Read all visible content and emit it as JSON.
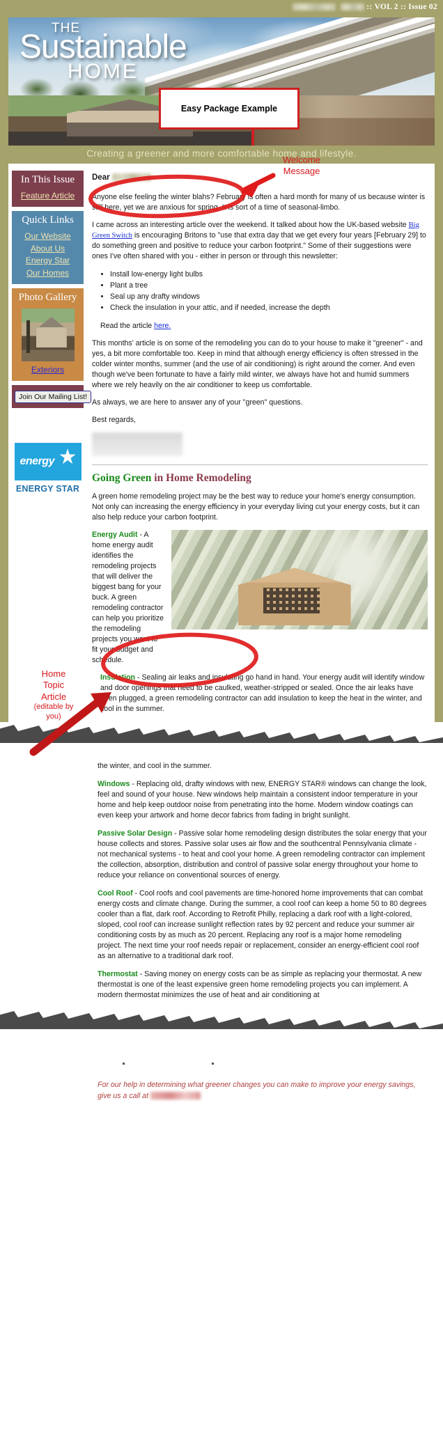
{
  "header": {
    "issue_separator": "::",
    "volume": "VOL 2",
    "issue": "Issue 02",
    "issue_line": ":: VOL 2 :: Issue 02"
  },
  "masthead": {
    "the": "THE",
    "sustainable": "Sustainable",
    "home": "HOME",
    "tagline": "Creating a greener and more comfortable home and lifestyle."
  },
  "callout": {
    "title": "Easy Package Example"
  },
  "annotations": [
    {
      "id": "welcome",
      "label": "Welcome\nMessage",
      "line1": "Welcome",
      "line2": "Message"
    },
    {
      "id": "home-topic",
      "line1": "Home",
      "line2": "Topic",
      "line3": "Article",
      "line4": "(editable by",
      "line5": "you)"
    }
  ],
  "annotation_welcome": {
    "line1": "Welcome",
    "line2": "Message"
  },
  "annotation_topic": {
    "line1": "Home",
    "line2": "Topic",
    "line3": "Article",
    "line4": "(editable by",
    "line5": "you)"
  },
  "sidebar": {
    "in_this_issue": {
      "title": "In This Issue",
      "links": [
        "Feature Article"
      ]
    },
    "quick_links": {
      "title": "Quick Links",
      "links": [
        "Our Website",
        "About Us",
        "Energy Star",
        "Our Homes"
      ]
    },
    "photo_gallery": {
      "title": "Photo Gallery",
      "caption": "Exteriors"
    },
    "mailing_list": {
      "button_label": "Join Our Mailing List!"
    },
    "energy_star": {
      "word": "energy",
      "label": "ENERGY STAR"
    }
  },
  "letter": {
    "greeting": "Dear",
    "greeting_name_redacted": true,
    "p1": "Anyone else feeling the winter blahs? February is often a hard month for many of us because winter is still here, yet we are anxious for spring. It is sort of a time of seasonal-limbo.",
    "p2_before_link": "I came across an interesting article over the weekend. It talked about how the UK-based website ",
    "p2_link": "Big Green Switch",
    "p2_after_link": " is encouraging Britons to \"use that extra day that we get every four years [February 29] to do something green and positive to reduce your carbon footprint.\" Some of their suggestions were ones I've often shared with you - either in person or through this newsletter:",
    "bullets": [
      "Install low-energy light bulbs",
      "Plant a tree",
      "Seal up any drafty windows",
      "Check the insulation in your attic, and if needed, increase the depth"
    ],
    "read_article_before": "Read the article ",
    "read_article_link": "here.",
    "p3": "This months' article is on some of the remodeling you can do to your house to make it \"greener\" - and yes, a bit more comfortable too. Keep in mind that although energy efficiency is often stressed in the colder winter months, summer (and the use of air conditioning) is right around the corner. And even though we've been fortunate to have a fairly mild winter, we always have hot and humid summers where we rely heavily on the air conditioner to keep us comfortable.",
    "p4": "As always, we are here to answer any of your \"green\" questions.",
    "closing": "Best regards,"
  },
  "article": {
    "title_green": "Going Green",
    "title_rest": " in Home Remodeling",
    "intro": "A green home remodeling project may be the best way to reduce your home's energy consumption. Not only can increasing the energy efficiency in your everyday living cut your energy costs, but it can also help reduce your carbon footprint.",
    "sections": [
      {
        "term": "Energy Audit",
        "text": " - A home energy audit identifies the remodeling projects that will deliver the biggest bang for your buck. A green remodeling contractor can help you prioritize the remodeling projects you want to fit your budget and schedule."
      },
      {
        "term": "Insulation",
        "text": " - Sealing air leaks and insulating go hand in hand. Your energy audit will identify window and door openings that need to be caulked, weather-stripped or sealed. Once the air leaks have been plugged, a green remodeling contractor can add insulation to keep the heat in the winter, and cool in the summer."
      },
      {
        "term": "Windows",
        "text": " - Replacing old, drafty windows with new, ENERGY STAR® windows can change the look, feel and sound of your house. New windows help maintain a consistent indoor temperature in your home and help keep outdoor noise from penetrating into the home. Modern window coatings can even keep your artwork and home decor fabrics from fading in bright sunlight."
      },
      {
        "term": "Passive Solar Design",
        "text": " - Passive solar home remodeling design distributes the solar energy that your house collects and stores. Passive solar uses air flow and the southcentral Pennsylvania climate - not mechanical systems - to heat and cool your home. A green remodeling contractor can implement the collection, absorption, distribution and control of passive solar energy throughout your home to reduce your reliance on conventional sources of energy."
      },
      {
        "term": "Cool Roof",
        "text": " - Cool roofs and cool pavements are time-honored home improvements that can combat energy costs and climate change. During the summer, a cool roof can keep a home 50 to 80 degrees cooler than a flat, dark roof. According to Retrofit Philly, replacing a dark roof with a light-colored, sloped, cool roof can increase sunlight reflection rates by 92 percent and reduce your summer air conditioning costs by as much as 20 percent. Replacing any roof is a major home remodeling project. The next time your roof needs repair or replacement, consider an energy-efficient cool roof as an alternative to a traditional dark roof."
      },
      {
        "term": "Thermostat",
        "text": " - Saving money on energy costs can be as simple as replacing your thermostat. A new thermostat is one of the least expensive green home remodeling projects you can implement. A modern thermostat minimizes the use of heat and air conditioning at"
      }
    ]
  },
  "footer": {
    "note_line1": "For our help in determining what greener changes you can make to",
    "note_line2": "improve your energy savings, give us a call at"
  },
  "colors": {
    "olive": "#a5a26b",
    "maroon": "#7e3f4d",
    "blue": "#5589ab",
    "tan": "#c98a45",
    "annotation_red": "#d6191c",
    "link_blue": "#1b2fd6",
    "term_green": "#1a8a1a",
    "energy_star_blue": "#23a5dd"
  }
}
